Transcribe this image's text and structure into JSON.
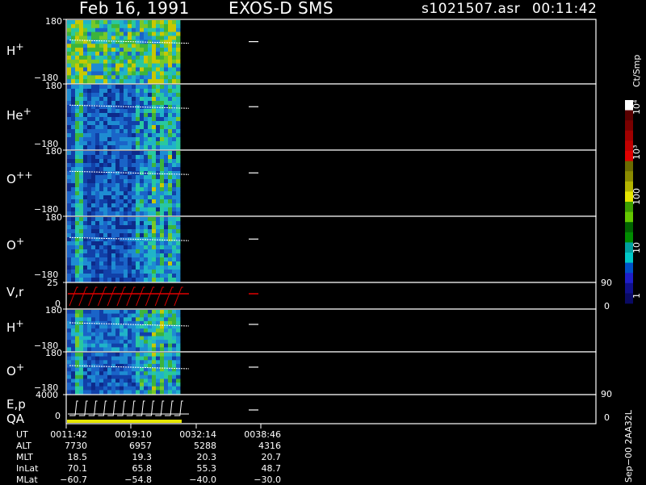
{
  "header": {
    "date": "Feb 16, 1991",
    "instrument": "EXOS-D SMS",
    "file": "s1021507.asr",
    "time": "00:11:42"
  },
  "panels": [
    {
      "label": "H",
      "sup": "+",
      "ymax": "180",
      "ymin": "−180"
    },
    {
      "label": "He",
      "sup": "+",
      "ymax": "180",
      "ymin": "−180"
    },
    {
      "label": "O",
      "sup": "++",
      "ymax": "180",
      "ymin": "−180"
    },
    {
      "label": "O",
      "sup": "+",
      "ymax": "180",
      "ymin": "−180"
    },
    {
      "label": "V,r",
      "sup": "",
      "ymax": "25",
      "ymin": "0",
      "rmax": "90",
      "rmin": "0"
    },
    {
      "label": "H",
      "sup": "+",
      "ymax": "180",
      "ymin": "−180"
    },
    {
      "label": "O",
      "sup": "+",
      "ymax": "180",
      "ymin": "−180"
    },
    {
      "label": "E,p",
      "label2": "QA",
      "sup": "",
      "ymax": "4000",
      "ymin": "0",
      "rmax": "90",
      "rmin": "0"
    }
  ],
  "colorbar": {
    "unit": "Ct/Smp",
    "labels": [
      "10⁴",
      "10³",
      "100",
      "10",
      "1"
    ],
    "colors": [
      "#ffffff",
      "#5a0000",
      "#7a0000",
      "#a00000",
      "#c00000",
      "#e00000",
      "#6b6b00",
      "#8a8a00",
      "#b4b400",
      "#e6e600",
      "#3c9e00",
      "#64c800",
      "#006400",
      "#008c00",
      "#00a0a0",
      "#00c8c8",
      "#0050c8",
      "#1e1ec8",
      "#10108c",
      "#0a0a64"
    ]
  },
  "ut_table": {
    "row_labels": [
      "UT",
      "ALT",
      "MLT",
      "InLat",
      "MLat"
    ],
    "columns": [
      [
        "0011:42",
        "7730",
        "18.5",
        "70.1",
        "−60.7"
      ],
      [
        "0019:10",
        "6957",
        "19.3",
        "65.8",
        "−54.8"
      ],
      [
        "0032:14",
        "5288",
        "20.3",
        "55.3",
        "−40.0"
      ],
      [
        "0038:46",
        "4316",
        "20.7",
        "48.7",
        "−30.0"
      ]
    ]
  },
  "footer_code": "Sep−00 2AA32L"
}
